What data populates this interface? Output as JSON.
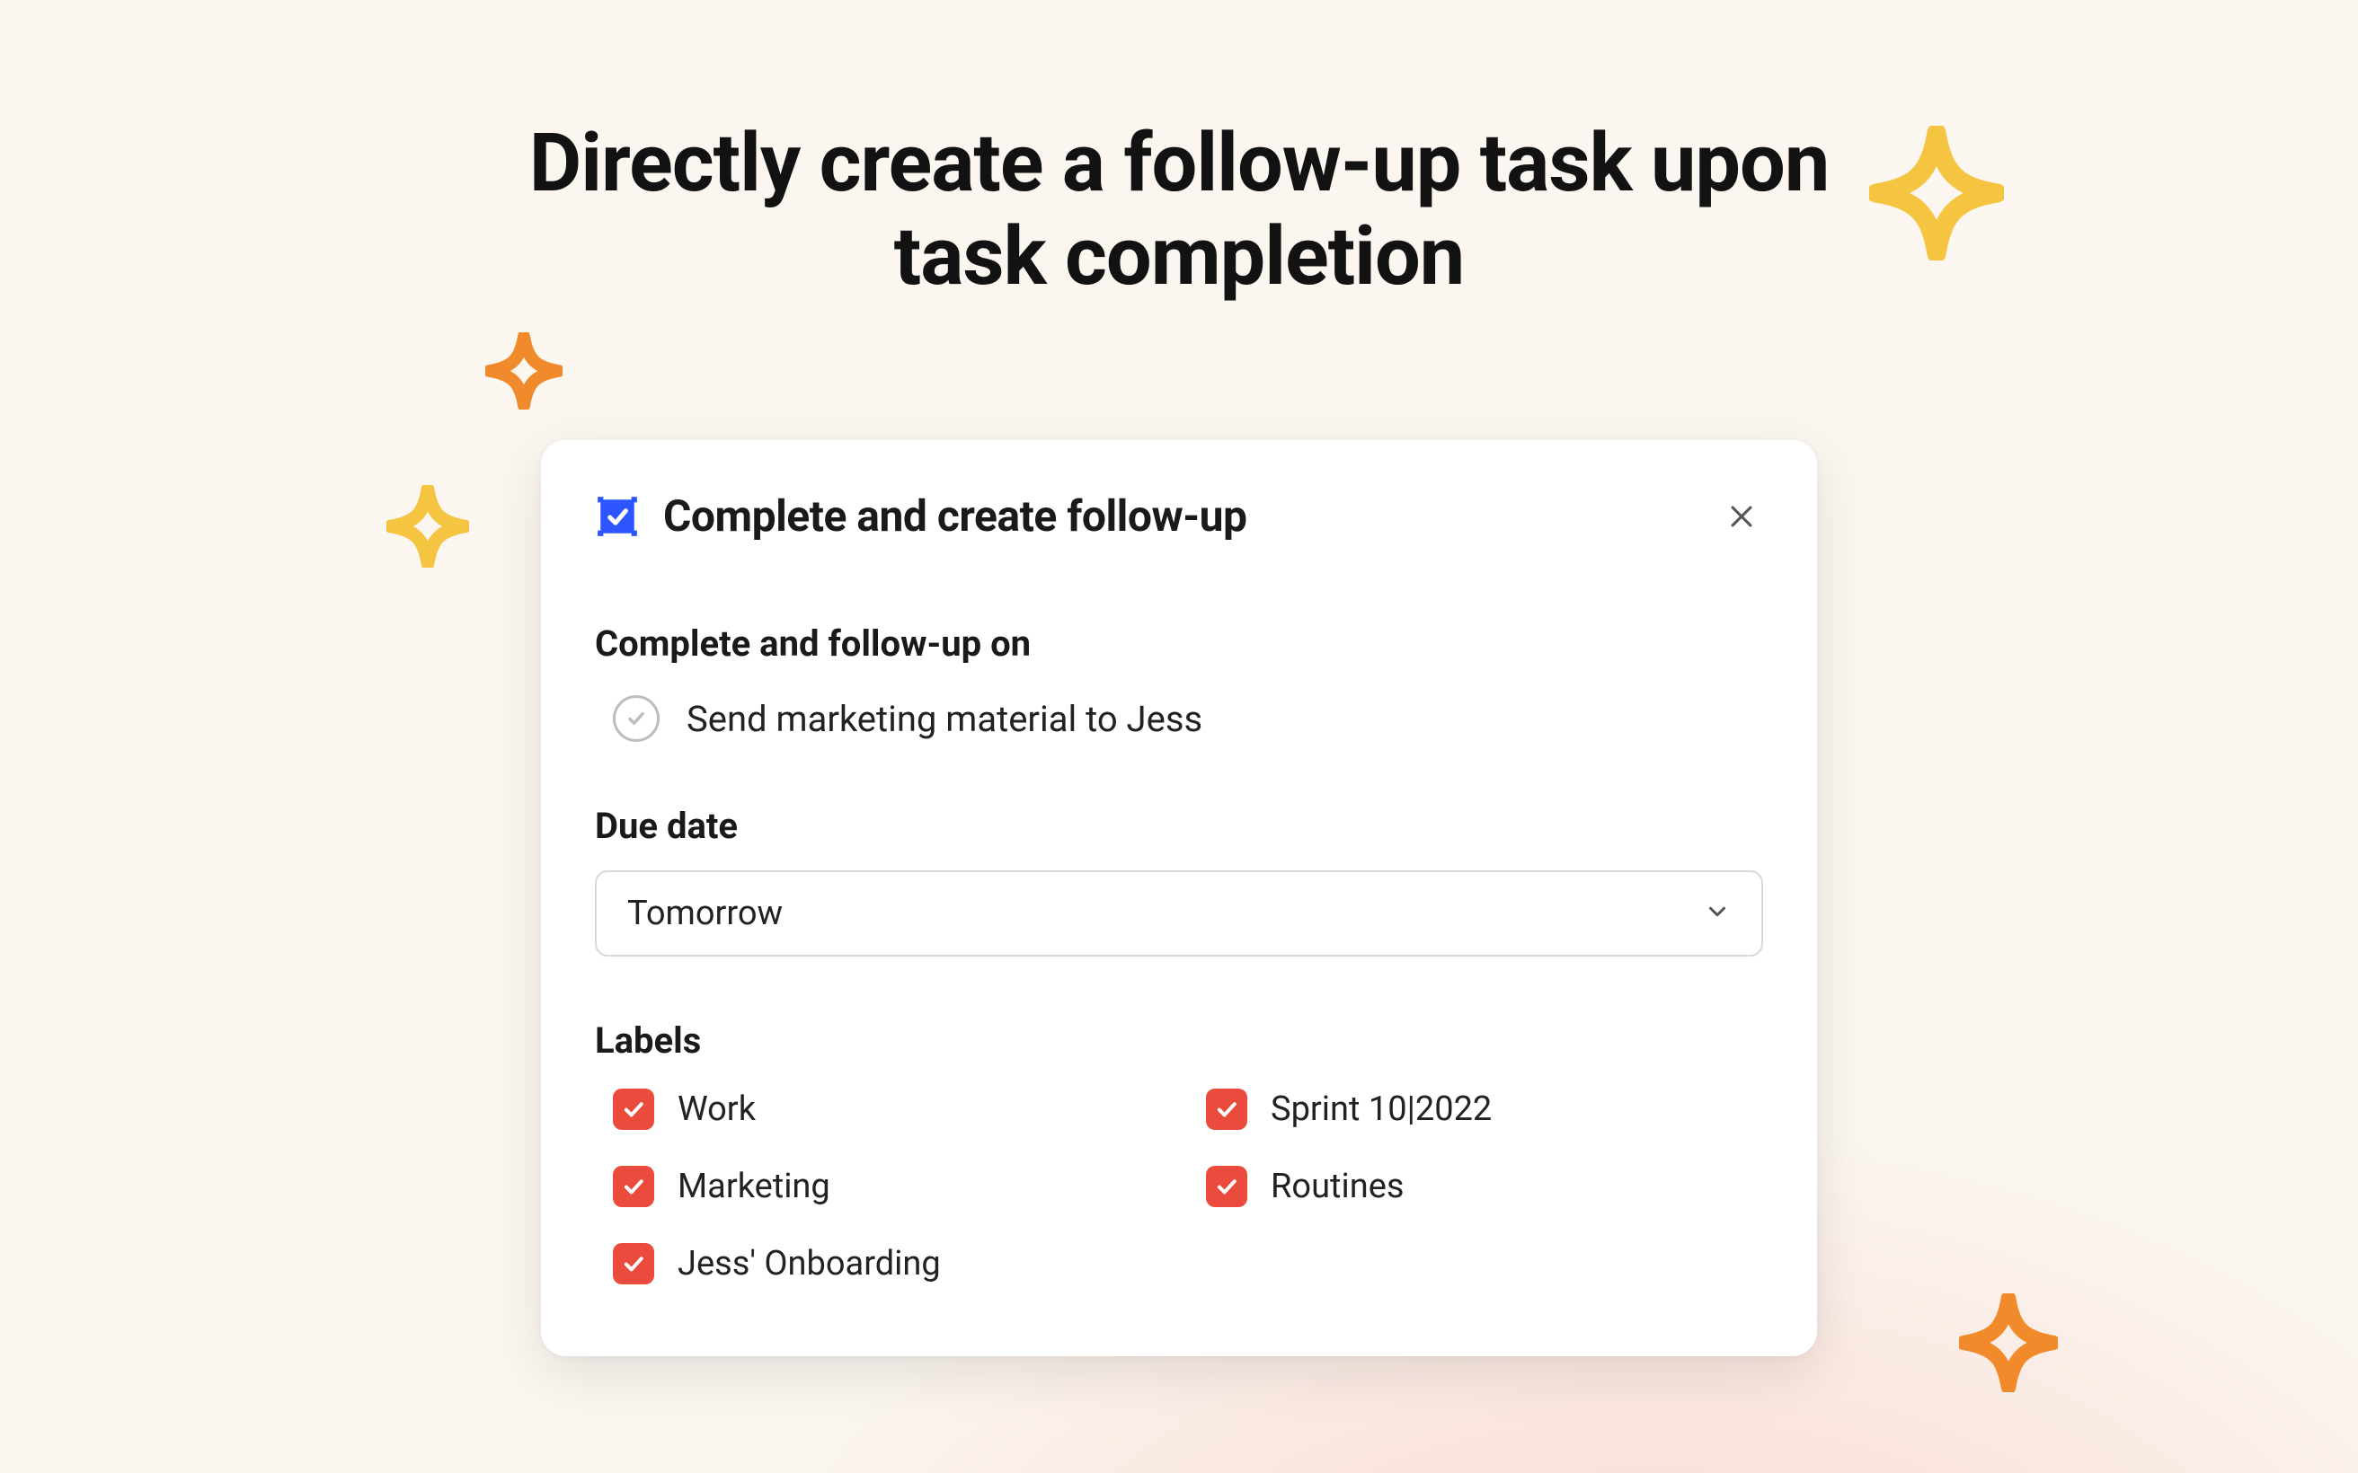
{
  "hero": {
    "title": "Directly create a follow-up task upon task completion"
  },
  "modal": {
    "title": "Complete and create follow-up",
    "sections": {
      "follow_up_heading": "Complete and follow-up on",
      "task_title": "Send marketing material to Jess",
      "due_date_heading": "Due date",
      "due_date_value": "Tomorrow",
      "labels_heading": "Labels",
      "labels": [
        {
          "text": "Work",
          "checked": true
        },
        {
          "text": "Sprint 10|2022",
          "checked": true
        },
        {
          "text": "Marketing",
          "checked": true
        },
        {
          "text": "Routines",
          "checked": true
        },
        {
          "text": "Jess' Onboarding",
          "checked": true
        }
      ]
    }
  },
  "colors": {
    "accent_red": "#ea4b3c",
    "accent_blue": "#2d55ff"
  }
}
